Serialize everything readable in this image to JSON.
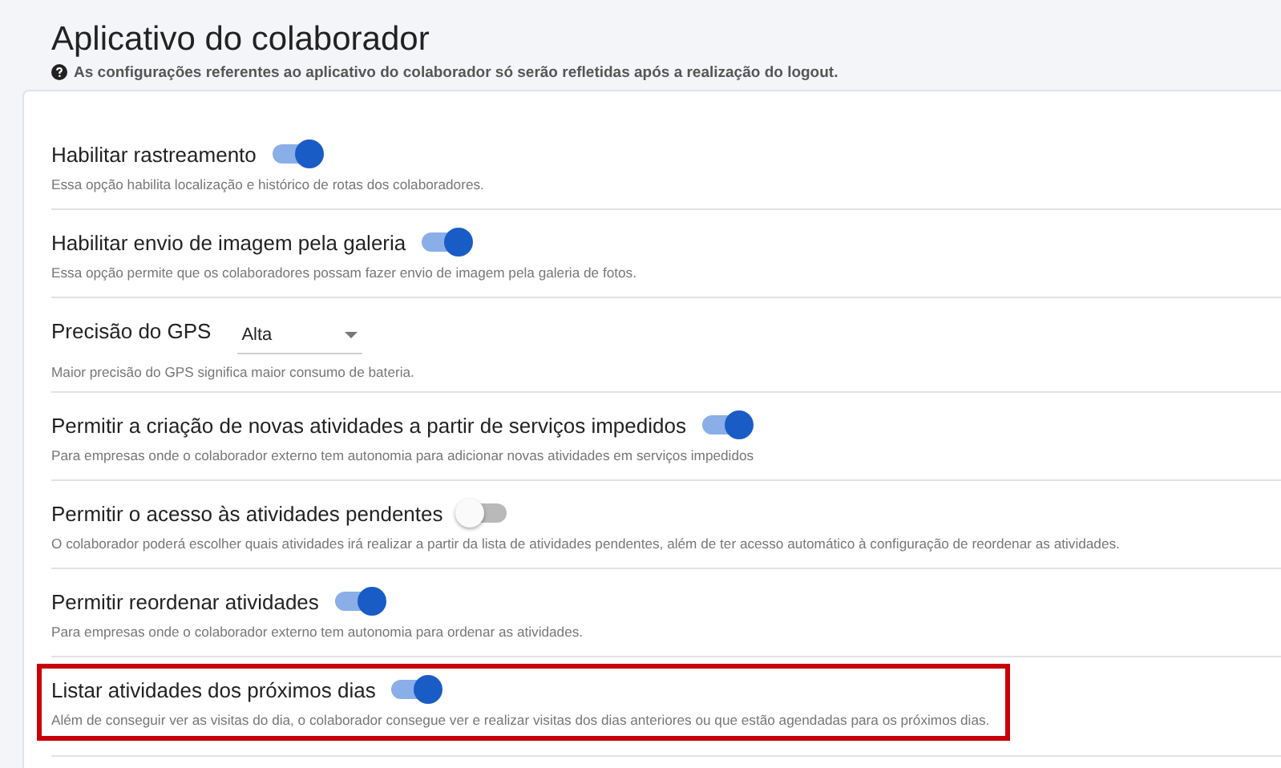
{
  "page": {
    "title": "Aplicativo do colaborador",
    "note": "As configurações referentes ao aplicativo do colaborador só serão refletidas após a realização do logout."
  },
  "settings": [
    {
      "kind": "toggle",
      "label": "Habilitar rastreamento",
      "on": true,
      "description": "Essa opção habilita localização e histórico de rotas dos colaboradores.",
      "highlighted": false
    },
    {
      "kind": "toggle",
      "label": "Habilitar envio de imagem pela galeria",
      "on": true,
      "description": "Essa opção permite que os colaboradores possam fazer envio de imagem pela galeria de fotos.",
      "highlighted": false
    },
    {
      "kind": "select",
      "label": "Precisão do GPS",
      "value": "Alta",
      "description": "Maior precisão do GPS significa maior consumo de bateria.",
      "highlighted": false
    },
    {
      "kind": "toggle",
      "label": "Permitir a criação de novas atividades a partir de serviços impedidos",
      "on": true,
      "description": "Para empresas onde o colaborador externo tem autonomia para adicionar novas atividades em serviços impedidos",
      "highlighted": false
    },
    {
      "kind": "toggle",
      "label": "Permitir o acesso às atividades pendentes",
      "on": false,
      "description": "O colaborador poderá escolher quais atividades irá realizar a partir da lista de atividades pendentes, além de ter acesso automático à configuração de reordenar as atividades.",
      "highlighted": false
    },
    {
      "kind": "toggle",
      "label": "Permitir reordenar atividades",
      "on": true,
      "description": "Para empresas onde o colaborador externo tem autonomia para ordenar as atividades.",
      "highlighted": false
    },
    {
      "kind": "toggle",
      "label": "Listar atividades dos próximos dias",
      "on": true,
      "description": "Além de conseguir ver as visitas do dia, o colaborador consegue ver e realizar visitas dos dias anteriores ou que estão agendadas para os próximos dias.",
      "highlighted": true
    }
  ]
}
